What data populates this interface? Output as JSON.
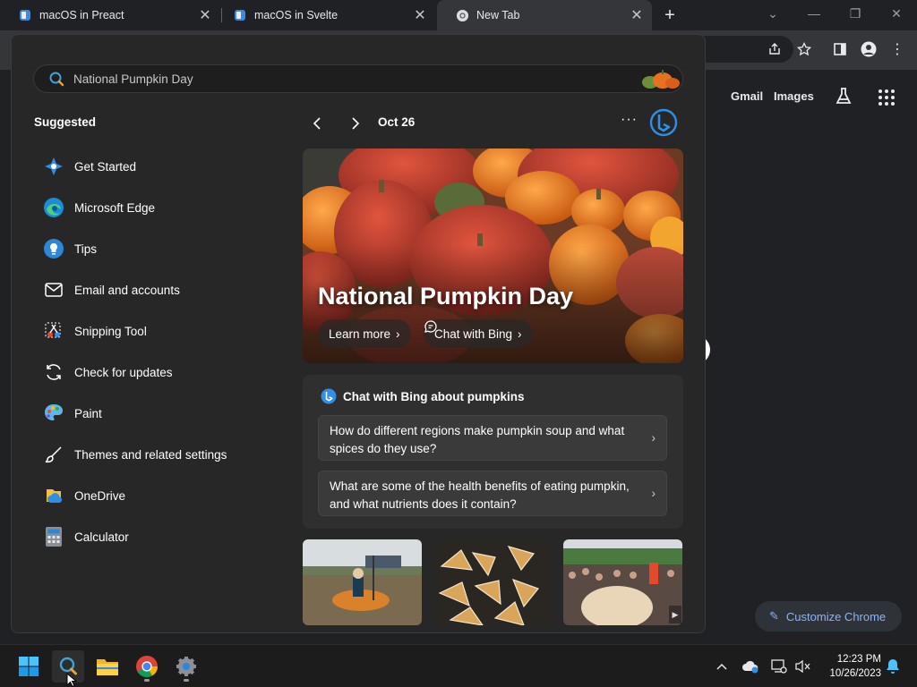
{
  "browser": {
    "tabs": [
      {
        "title": "macOS in Preact",
        "active": false
      },
      {
        "title": "macOS in Svelte",
        "active": false
      },
      {
        "title": "New Tab",
        "active": true
      }
    ],
    "ntp": {
      "gmail": "Gmail",
      "images": "Images",
      "customize": "Customize Chrome"
    }
  },
  "search_panel": {
    "query": "National Pumpkin Day",
    "suggested_title": "Suggested",
    "apps": [
      {
        "label": "Get Started",
        "icon": "get-started-icon"
      },
      {
        "label": "Microsoft Edge",
        "icon": "edge-icon"
      },
      {
        "label": "Tips",
        "icon": "tips-icon"
      },
      {
        "label": "Email and accounts",
        "icon": "mail-icon"
      },
      {
        "label": "Snipping Tool",
        "icon": "snipping-tool-icon"
      },
      {
        "label": "Check for updates",
        "icon": "refresh-icon"
      },
      {
        "label": "Paint",
        "icon": "paint-icon"
      },
      {
        "label": "Themes and related settings",
        "icon": "brush-icon"
      },
      {
        "label": "OneDrive",
        "icon": "onedrive-icon"
      },
      {
        "label": "Calculator",
        "icon": "calculator-icon"
      }
    ],
    "highlight": {
      "date": "Oct 26",
      "more": "···",
      "hero_title": "National Pumpkin Day",
      "learn_more": "Learn more",
      "chat_with_bing": "Chat with Bing",
      "chat_card_title": "Chat with Bing about pumpkins",
      "questions": [
        "How do different regions make pumpkin soup and what spices do they use?",
        "What are some of the health benefits of eating pumpkin, and what nutrients does it contain?"
      ]
    }
  },
  "taskbar": {
    "apps": [
      "start-icon",
      "search-icon",
      "file-explorer-icon",
      "chrome-icon",
      "settings-icon"
    ],
    "time": "12:23 PM",
    "date": "10/26/2023"
  },
  "colors": {
    "accent": "#8ab4f8",
    "panel_bg": "#272727",
    "chrome_dark": "#202124",
    "pumpkin_orange": "#e8711f",
    "pumpkin_red": "#b8332b"
  }
}
